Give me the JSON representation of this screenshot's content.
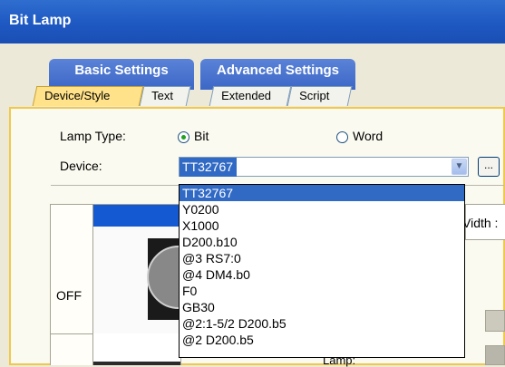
{
  "window": {
    "title": "Bit Lamp"
  },
  "tab_groups": [
    {
      "label": "Basic Settings"
    },
    {
      "label": "Advanced Settings"
    }
  ],
  "tabs": [
    {
      "label": "Device/Style"
    },
    {
      "label": "Text"
    },
    {
      "label": "Extended"
    },
    {
      "label": "Script"
    }
  ],
  "form": {
    "lamp_type_label": "Lamp Type:",
    "lamp_type_options": [
      "Bit",
      "Word"
    ],
    "lamp_type_selected": "Bit",
    "device_label": "Device:",
    "device_value": "TT32767",
    "browse_label": "...",
    "width_label": "Vidth :"
  },
  "device_dropdown": {
    "items": [
      "TT32767",
      "Y0200",
      "X1000",
      "D200.b10",
      "@3 RS7:0",
      "@4 DM4.b0",
      "F0",
      "GB30",
      "@2:1-5/2 D200.b5",
      "@2 D200.b5"
    ],
    "selected_index": 0
  },
  "preview": {
    "state_off_label": "OFF",
    "lamp_label_partial": "Lamp:"
  },
  "colors": {
    "title_bar": "#1e58c2",
    "tab_group": "#3c67c6",
    "active_tab": "#ffe28a",
    "selection": "#316ac5"
  }
}
